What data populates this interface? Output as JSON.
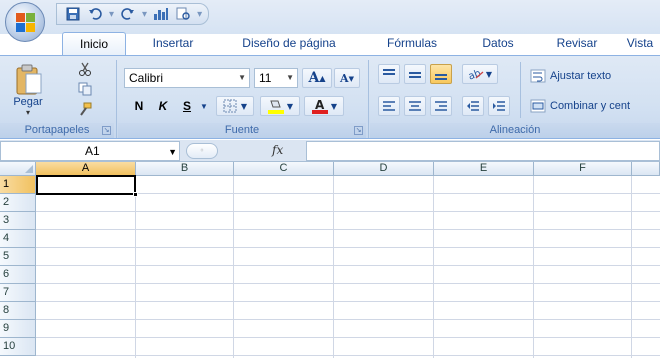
{
  "quick_access": {
    "icons": [
      "save-icon",
      "undo-icon",
      "redo-icon",
      "chart-icon",
      "print-preview-icon"
    ],
    "dropdown_glyph": "▾",
    "sep_glyph": "·"
  },
  "tabs": [
    {
      "label": "Inicio",
      "active": true
    },
    {
      "label": "Insertar"
    },
    {
      "label": "Diseño de página"
    },
    {
      "label": "Fórmulas"
    },
    {
      "label": "Datos"
    },
    {
      "label": "Revisar"
    },
    {
      "label": "Vista"
    }
  ],
  "clipboard": {
    "paste_label": "Pegar",
    "group_label": "Portapapeles"
  },
  "font": {
    "font_name": "Calibri",
    "font_size": "11",
    "grow_label": "A",
    "shrink_label": "A",
    "bold_label": "N",
    "italic_label": "K",
    "underline_label": "S",
    "group_label": "Fuente"
  },
  "alignment": {
    "wrap_text_label": "Ajustar texto",
    "merge_label": "Combinar y cent",
    "group_label": "Alineación"
  },
  "formula_bar": {
    "name_box": "A1",
    "fx_label": "fx",
    "formula": ""
  },
  "grid": {
    "columns": [
      "A",
      "B",
      "C",
      "D",
      "E",
      "F"
    ],
    "rows": [
      "1",
      "2",
      "3",
      "4",
      "5",
      "6",
      "7",
      "8",
      "9",
      "10"
    ],
    "active_cell": "A1"
  },
  "colors": {
    "accent": "#15428b",
    "ribbon": "#d3e1f2",
    "active_header": "#f1c15f"
  }
}
